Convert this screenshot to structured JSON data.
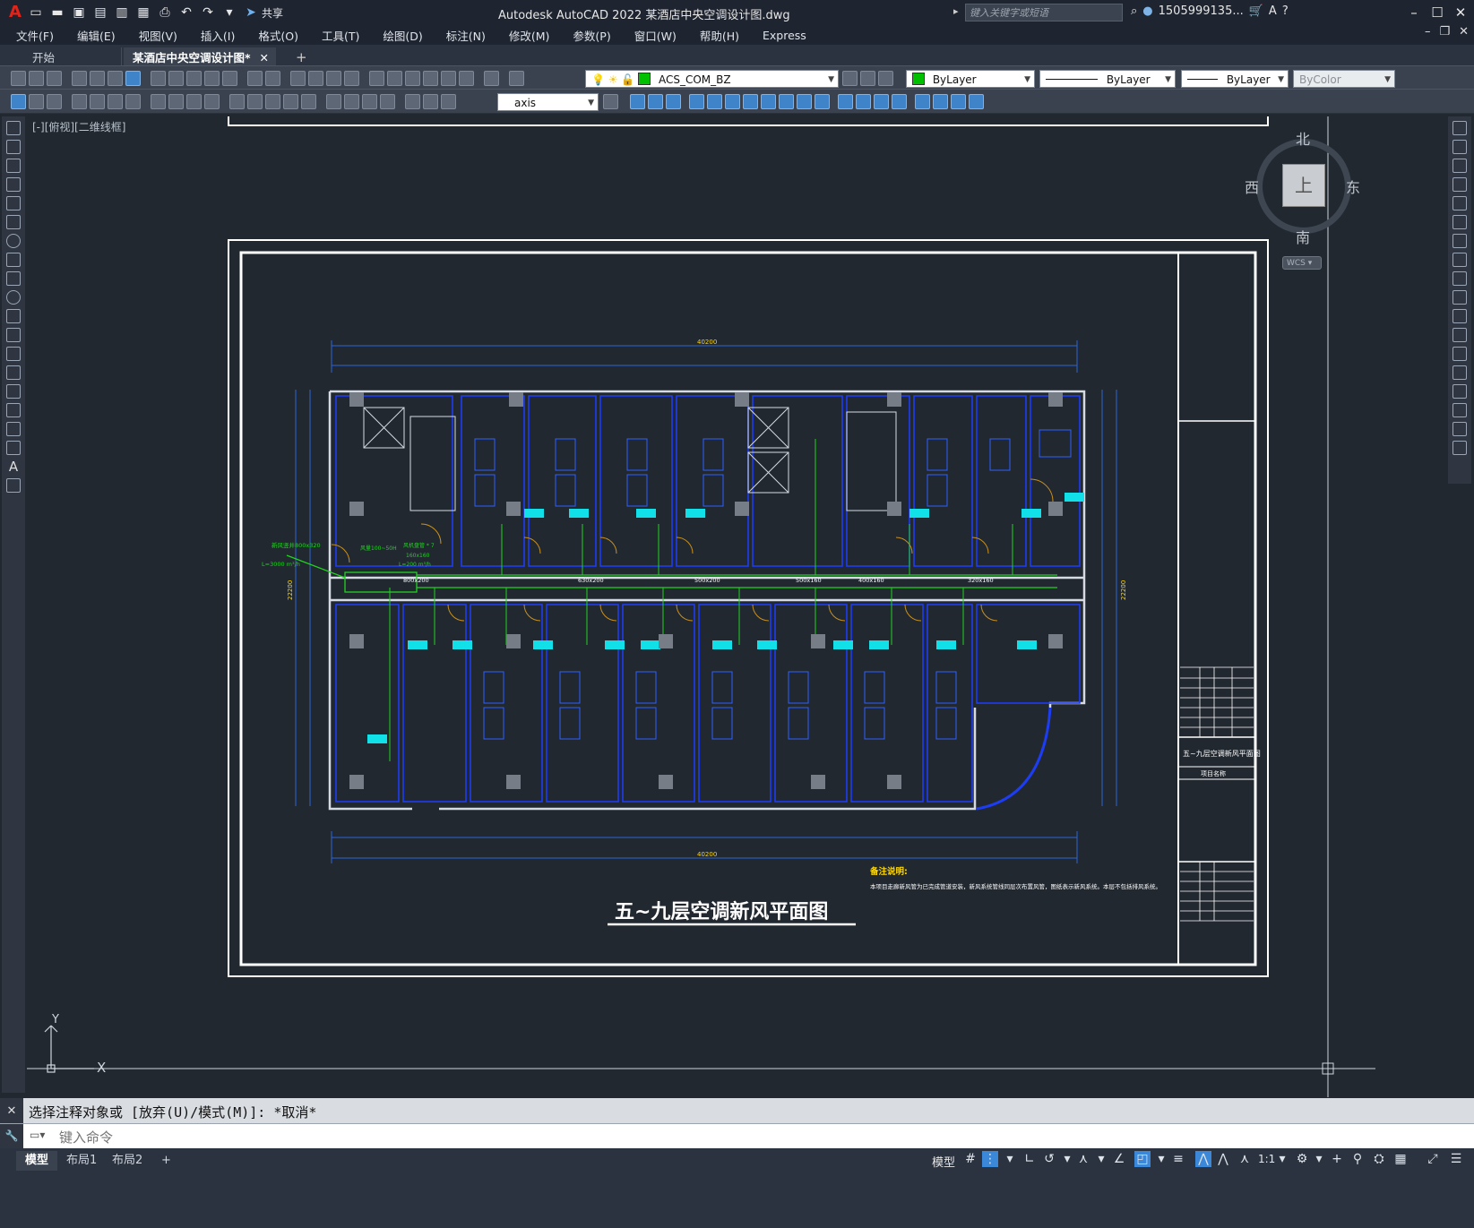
{
  "app": {
    "title": "Autodesk AutoCAD 2022    某酒店中央空调设计图.dwg",
    "share_label": "共享",
    "search_placeholder": "键入关键字或短语",
    "user_name": "1505999135..."
  },
  "menu": [
    "文件(F)",
    "编辑(E)",
    "视图(V)",
    "插入(I)",
    "格式(O)",
    "工具(T)",
    "绘图(D)",
    "标注(N)",
    "修改(M)",
    "参数(P)",
    "窗口(W)",
    "帮助(H)",
    "Express"
  ],
  "tabs": {
    "start": "开始",
    "active": "某酒店中央空调设计图*",
    "add": "+"
  },
  "toolbar": {
    "layer_name": "ACS_COM_BZ",
    "color": "ByLayer",
    "linetype": "ByLayer",
    "lineweight": "ByLayer",
    "plotstyle": "ByColor",
    "dimstyle": "axis"
  },
  "viewport": {
    "label": "[-][俯视][二维线框]"
  },
  "viewcube": {
    "north": "北",
    "south": "南",
    "east": "东",
    "west": "西",
    "top": "上",
    "wcs": "WCS"
  },
  "drawing": {
    "title": "五~九层空调新风平面图",
    "notes_heading": "备注说明:",
    "notes_text": "本项目走廊新风管为已完成管道安装，新风系统管线同层次布置风管，图纸表示新风系统。本层不包括排风系统。",
    "titleblock_name": "五~九层空调新风平面图",
    "titleblock_project": "项目名称",
    "top_total": "40200",
    "bottom_total": "40200",
    "right_total": "22200",
    "left_total": "22200",
    "duct_labels": [
      "800x200",
      "630x200",
      "500x200",
      "500x160",
      "400x160",
      "320x160"
    ],
    "annotations": [
      "新风竖井800x320",
      "L=3000 m³/h",
      "风量100~50H",
      "L=200 m³/h",
      "风机盘管 * 7",
      "160x160"
    ]
  },
  "ucs": {
    "x": "X",
    "y": "Y"
  },
  "command": {
    "history": "选择注释对象或 [放弃(U)/模式(M)]: *取消*",
    "placeholder": "键入命令"
  },
  "layouts": [
    "模型",
    "布局1",
    "布局2"
  ],
  "status": {
    "model": "模型",
    "scale": "1:1"
  },
  "colors": {
    "accent": "#3b87d8",
    "layer_swatch": "#00c000",
    "title_red": "#e2231a"
  }
}
